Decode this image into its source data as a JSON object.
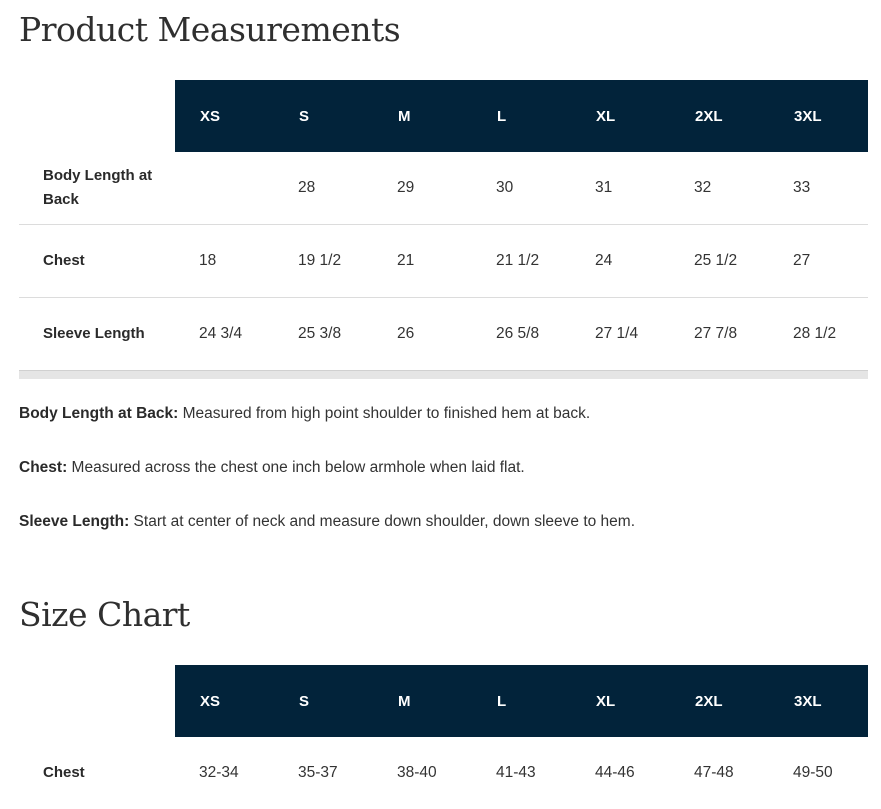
{
  "measurements": {
    "title": "Product Measurements",
    "sizes": [
      "XS",
      "S",
      "M",
      "L",
      "XL",
      "2XL",
      "3XL"
    ],
    "rows": [
      {
        "label": "Body Length at Back",
        "values": [
          "",
          "28",
          "29",
          "30",
          "31",
          "32",
          "33"
        ]
      },
      {
        "label": "Chest",
        "values": [
          "18",
          "19 1/2",
          "21",
          "21 1/2",
          "24",
          "25 1/2",
          "27"
        ]
      },
      {
        "label": "Sleeve Length",
        "values": [
          "24 3/4",
          "25 3/8",
          "26",
          "26 5/8",
          "27 1/4",
          "27 7/8",
          "28 1/2"
        ]
      }
    ]
  },
  "notes": [
    {
      "term": "Body Length at Back:",
      "text": " Measured from high point shoulder to finished hem at back."
    },
    {
      "term": "Chest:",
      "text": " Measured across the chest one inch below armhole when laid flat."
    },
    {
      "term": "Sleeve Length:",
      "text": " Start at center of neck and measure down shoulder, down sleeve to hem."
    }
  ],
  "size_chart": {
    "title": "Size Chart",
    "sizes": [
      "XS",
      "S",
      "M",
      "L",
      "XL",
      "2XL",
      "3XL"
    ],
    "rows": [
      {
        "label": "Chest",
        "values": [
          "32-34",
          "35-37",
          "38-40",
          "41-43",
          "44-46",
          "47-48",
          "49-50"
        ]
      }
    ]
  },
  "colors": {
    "header_bg": "#02233a",
    "header_text": "#ffffff",
    "row_divider": "#dcdcdc"
  }
}
